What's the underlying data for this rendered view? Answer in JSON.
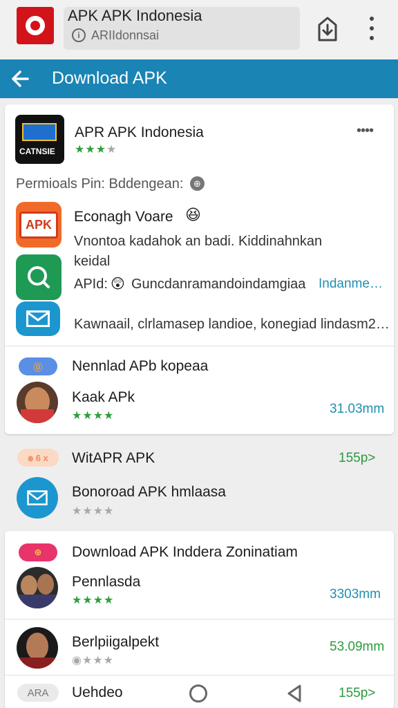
{
  "browser": {
    "title": "APK APK Indonesia",
    "url": "ARIIdonnsai",
    "info_glyph": "i",
    "logo_icon": "opera-logo-icon",
    "share_icon": "share-icon",
    "menu_icon": "kebab-menu-icon"
  },
  "header": {
    "title": "Download APK",
    "color": "#1a84b4"
  },
  "app_info": {
    "name": "APR APK Indonesia",
    "icon_text": "CATNSIE",
    "rating": 3,
    "more": "••••",
    "permissions": "Permioals Pin: Bddengean:"
  },
  "features": [
    {
      "title": "Econagh Voare",
      "emoji": "😆",
      "icon_text": "APK",
      "color": "#f26a2a"
    },
    {
      "line1": "Vnontoa kadahok an badi. Kiddinahnkan",
      "line2": "keidal",
      "color": "#1f9a55"
    },
    {
      "label": "APId:",
      "text": "Guncdanramandoindamgiaa",
      "link": "Indanme…",
      "emoji": "😲"
    },
    {
      "text": "Kawnaail, clrlamasep landioe, konegiad lindasm2…",
      "color": "#1c96cf"
    }
  ],
  "list": [
    {
      "title": "Nennlad APb kopeaa",
      "pill": "⓪",
      "pill_color": "#5b8fe6"
    },
    {
      "title": "Kaak APk",
      "rating": 4,
      "size": "31.03mm",
      "size_color": "#1f8fb0"
    },
    {
      "title": "WitAPR APK",
      "pill": "ꚛ 6 x",
      "pill_color": "#fbd9c5",
      "size": "155p>",
      "size_color": "#2a9a3e"
    },
    {
      "title": "Bonoroad APK hmlaasa",
      "rating": 0,
      "icon": "mail-icon"
    },
    {
      "title": "Download APK Inddera Zoninatiam",
      "pill": "⊕",
      "pill_color": "#e8336b"
    },
    {
      "title": "Pennlasda",
      "rating": 4,
      "size": "3303mm",
      "size_color": "#1f8fb0"
    },
    {
      "title": "Berlpiigalpekt",
      "rating": 1,
      "size": "53.09mm",
      "size_color": "#2a9a3e"
    },
    {
      "title": "Uehdeo",
      "pill": "ARA",
      "pill_color": "#eaeaea",
      "size": "155p>",
      "size_color": "#2a9a3e"
    }
  ]
}
